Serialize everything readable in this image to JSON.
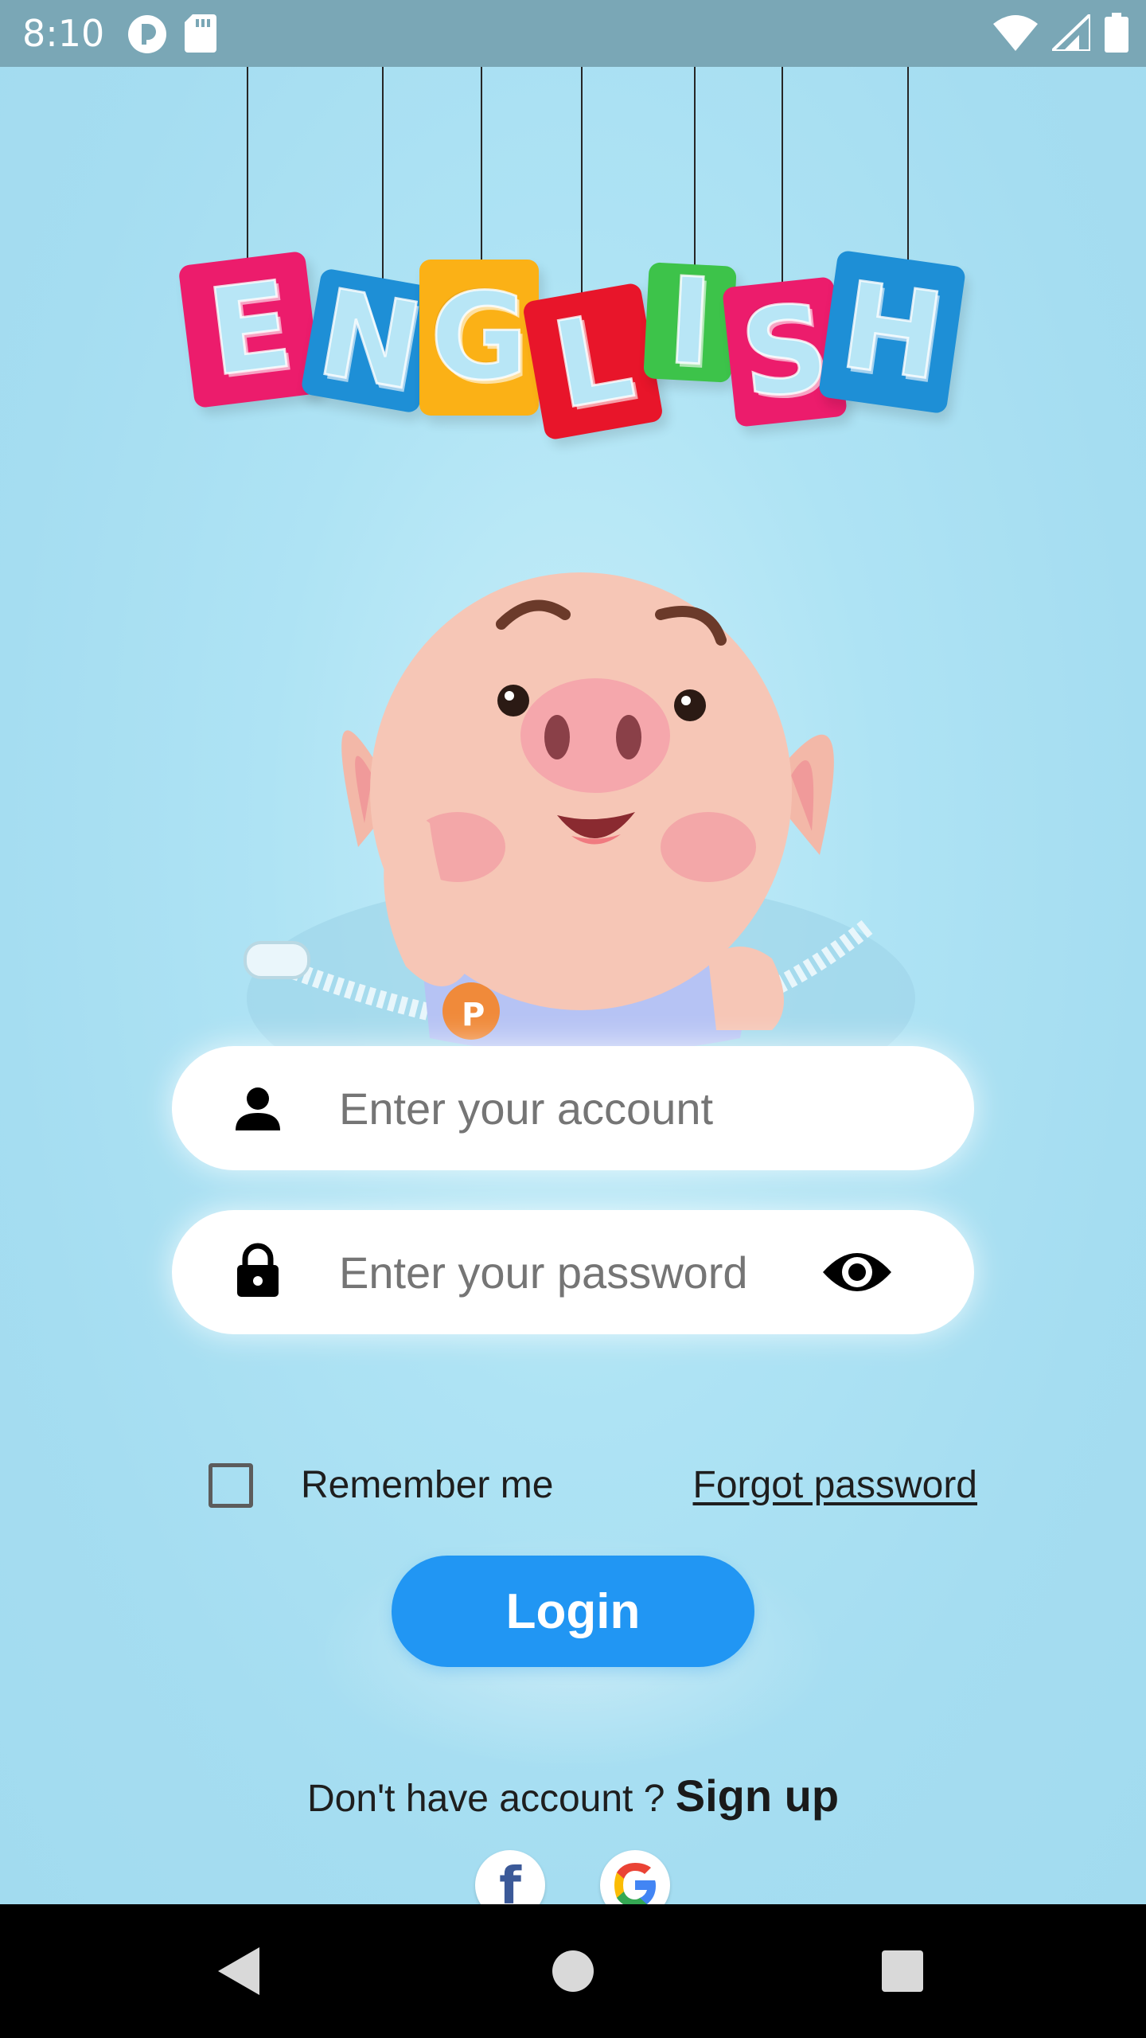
{
  "status_bar": {
    "time": "8:10",
    "icons": [
      "app-notification-icon",
      "sd-card-icon",
      "wifi-icon",
      "cellular-signal-icon",
      "battery-icon"
    ]
  },
  "banner": {
    "letters": [
      "E",
      "N",
      "G",
      "L",
      "I",
      "S",
      "H"
    ],
    "colors": [
      "#ec1c6c",
      "#1e8fd6",
      "#fbb116",
      "#e8152a",
      "#3dc34a",
      "#ec1c6c",
      "#1e8fd6"
    ]
  },
  "illustration": {
    "name": "piglet-in-pocket"
  },
  "form": {
    "account": {
      "placeholder": "Enter your account",
      "icon": "person-icon"
    },
    "password": {
      "placeholder": "Enter your password",
      "icon": "lock-icon",
      "toggle_icon": "eye-icon"
    },
    "remember_me": {
      "label": "Remember me",
      "checked": false
    },
    "forgot_password": "Forgot password",
    "login_button": "Login"
  },
  "signup": {
    "prompt": "Don't have account ? ",
    "link": "Sign up"
  },
  "social": {
    "facebook_glyph": "f",
    "providers": [
      "facebook-icon",
      "google-icon"
    ]
  },
  "nav": {
    "buttons": [
      "back-icon",
      "home-icon",
      "recents-icon"
    ]
  },
  "colors": {
    "background": "#a8e0f2",
    "status_bar": "#7aa7b6",
    "primary": "#2196f3",
    "field": "#ffffff"
  }
}
